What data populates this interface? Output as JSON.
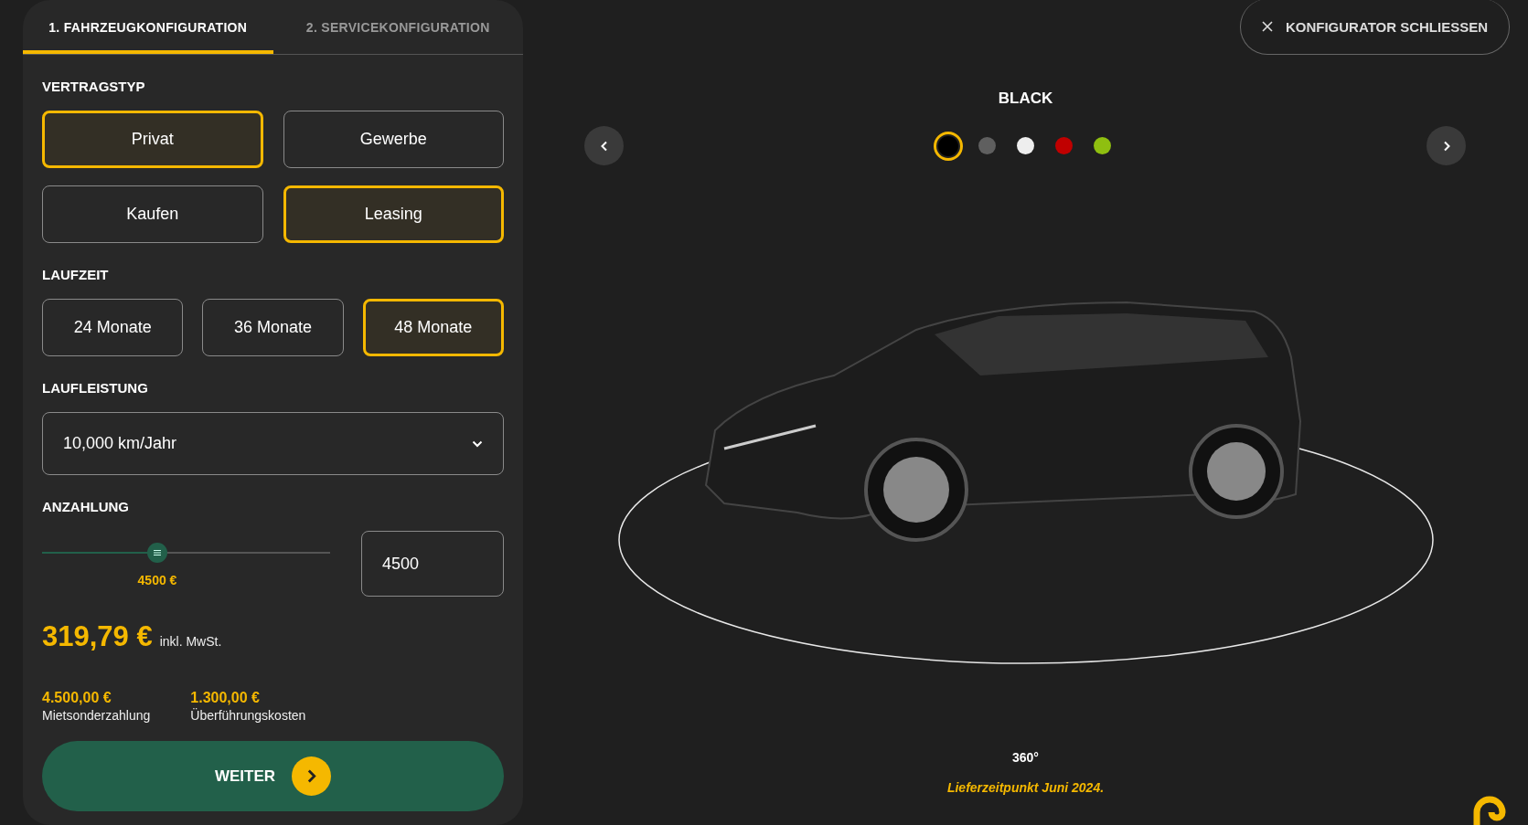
{
  "tabs": [
    {
      "label": "1. FAHRZEUGKONFIGURATION",
      "selected": true
    },
    {
      "label": "2. SERVICEKONFIGURATION",
      "selected": false
    }
  ],
  "contract_type": {
    "title": "VERTRAGSTYP",
    "customer_options": [
      {
        "label": "Privat",
        "selected": true
      },
      {
        "label": "Gewerbe",
        "selected": false
      }
    ],
    "payment_options": [
      {
        "label": "Kaufen",
        "selected": false
      },
      {
        "label": "Leasing",
        "selected": true
      }
    ]
  },
  "term": {
    "title": "LAUFZEIT",
    "options": [
      {
        "label": "24 Monate",
        "selected": false
      },
      {
        "label": "36 Monate",
        "selected": false
      },
      {
        "label": "48 Monate",
        "selected": true
      }
    ]
  },
  "mileage": {
    "title": "LAUFLEISTUNG",
    "value": "10,000 km/Jahr"
  },
  "down_payment": {
    "title": "ANZAHLUNG",
    "level": 0.4,
    "slider_label": "4500 €",
    "value": "4500"
  },
  "price": {
    "amount": "319,79 €",
    "note": "inkl. MwSt."
  },
  "fees": [
    {
      "amount": "4.500,00 €",
      "label": "Mietsonderzahlung"
    },
    {
      "amount": "1.300,00 €",
      "label": "Überführungskosten"
    }
  ],
  "next_button": "WEITER",
  "close_button": "KONFIGURATOR SCHLIESSEN",
  "color_name": "BLACK",
  "swatches": [
    {
      "color": "#000000",
      "selected": true
    },
    {
      "color": "#5f5f5f",
      "selected": false
    },
    {
      "color": "#eeeeee",
      "selected": false
    },
    {
      "color": "#c00000",
      "selected": false
    },
    {
      "color": "#8fbf10",
      "selected": false
    }
  ],
  "rotation_label": "360°",
  "delivery_note": "Lieferzeitpunkt Juni 2024."
}
